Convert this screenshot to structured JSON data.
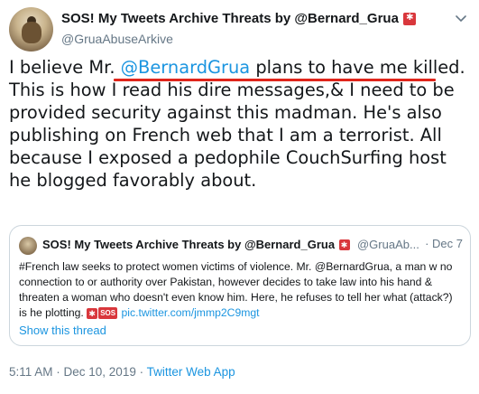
{
  "tweet": {
    "display_name": "SOS! My Tweets Archive Threats by @Bernard_Grua",
    "handle": "@GruaAbuseArkive",
    "text_before": "I believe Mr. ",
    "mention": "@BernardGrua",
    "text_after": " plans to have me killed. This is how I read his dire messages,& I need to be provided security against this madman. He's also publishing on French web that I am a terrorist. All because I exposed a pedophile CouchSurfing host he blogged favorably about.",
    "icons": {
      "avatar": "user-avatar",
      "badge": "alarm-light-emoji",
      "menu": "chevron-down-icon"
    }
  },
  "quote": {
    "display_name": "SOS! My Tweets Archive Threats by @Bernard_Grua",
    "handle": "@GruaAb...",
    "date": "· Dec 7",
    "text": "#French law seeks to protect women victims of violence. Mr. @BernardGrua, a man w no connection to or authority over Pakistan, however decides to take law into his hand & threaten a woman who doesn't even know him. Here, he refuses to tell her what (attack?) is he plotting. ",
    "sos_label": "SOS",
    "link": "pic.twitter.com/jmmp2C9mgt",
    "show_thread": "Show this thread"
  },
  "footer": {
    "timestamp": "5:11 AM · Dec 10, 2019 · ",
    "client": "Twitter Web App"
  },
  "colors": {
    "link": "#1b95e0",
    "secondary": "#657786",
    "underline": "#e0251b",
    "alarm": "#d9373c"
  }
}
